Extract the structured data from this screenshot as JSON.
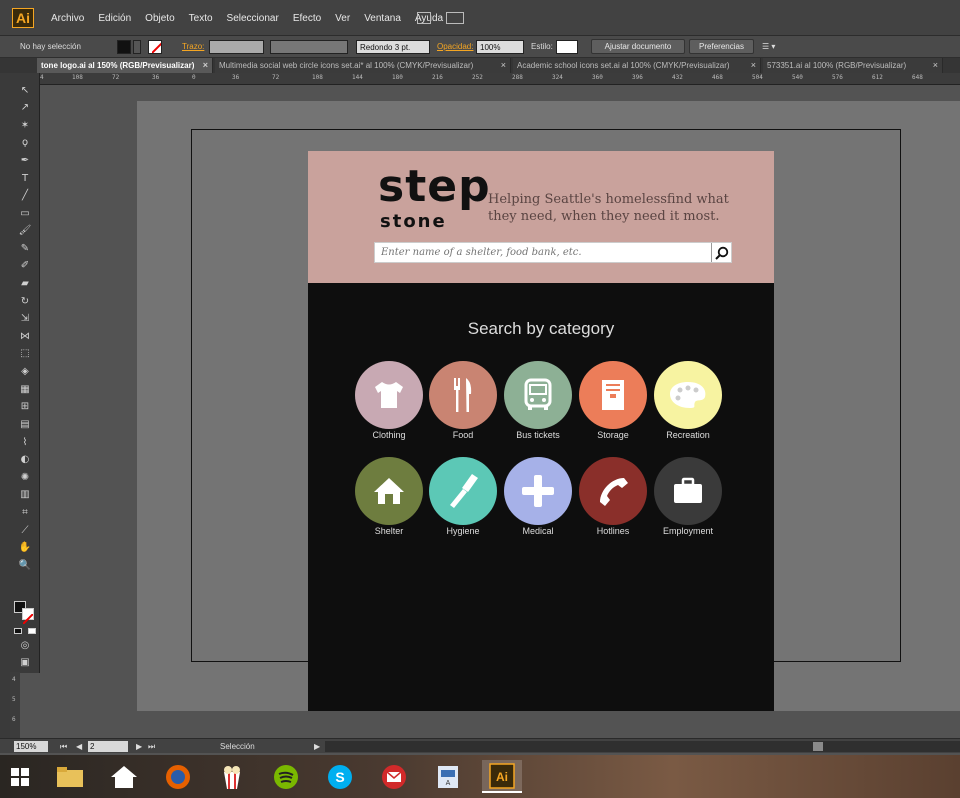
{
  "app": {
    "logo": "Ai"
  },
  "menu": [
    "Archivo",
    "Edición",
    "Objeto",
    "Texto",
    "Seleccionar",
    "Efecto",
    "Ver",
    "Ventana",
    "Ayuda"
  ],
  "controlbar": {
    "selection": "No hay selección",
    "stroke_label": "Trazo:",
    "brush": "Redondo 3 pt.",
    "opacity_label": "Opacidad:",
    "opacity_value": "100%",
    "style_label": "Estilo:",
    "adjust_button": "Ajustar documento",
    "prefs_button": "Preferencias"
  },
  "tabs": [
    {
      "label": "tone logo.ai al 150% (RGB/Previsualizar)",
      "active": true
    },
    {
      "label": "Multimedia social web circle icons set.ai* al 100% (CMYK/Previsualizar)"
    },
    {
      "label": "Academic school icons set.ai al 100% (CMYK/Previsualizar)"
    },
    {
      "label": "573351.ai al 100% (RGB/Previsualizar)"
    }
  ],
  "ruler_ticks": [
    "4",
    "108",
    "72",
    "36",
    "0",
    "36",
    "72",
    "108",
    "144",
    "180",
    "216",
    "252",
    "288",
    "324",
    "360",
    "396",
    "432",
    "468",
    "504",
    "540",
    "576",
    "612",
    "648"
  ],
  "design": {
    "logo_line1": "step",
    "logo_line2": "stone",
    "tagline": "Helping Seattle's homelessfind what they need, when they need it most.",
    "search_placeholder": "Enter name of a shelter, food bank, etc.",
    "category_title": "Search by category",
    "categories": [
      {
        "label": "Clothing",
        "color": "#c8a9b3",
        "icon": "tshirt-icon"
      },
      {
        "label": "Food",
        "color": "#c98472",
        "icon": "fork-knife-icon"
      },
      {
        "label": "Bus tickets",
        "color": "#8db095",
        "icon": "bus-icon"
      },
      {
        "label": "Storage",
        "color": "#ec7d59",
        "icon": "storage-icon"
      },
      {
        "label": "Recreation",
        "color": "#f7f3a1",
        "icon": "palette-icon"
      },
      {
        "label": "Shelter",
        "color": "#6e7d3f",
        "icon": "house-icon"
      },
      {
        "label": "Hygiene",
        "color": "#5cc8b6",
        "icon": "toothbrush-icon"
      },
      {
        "label": "Medical",
        "color": "#a6b1e8",
        "icon": "plus-icon"
      },
      {
        "label": "Hotlines",
        "color": "#8a2f2a",
        "icon": "phone-icon"
      },
      {
        "label": "Employment",
        "color": "#3a3a3a",
        "icon": "briefcase-icon"
      }
    ]
  },
  "statusbar": {
    "zoom": "150%",
    "artboard": "2",
    "tool": "Selección"
  },
  "vruler_ticks": [
    "4",
    "5",
    "6"
  ]
}
